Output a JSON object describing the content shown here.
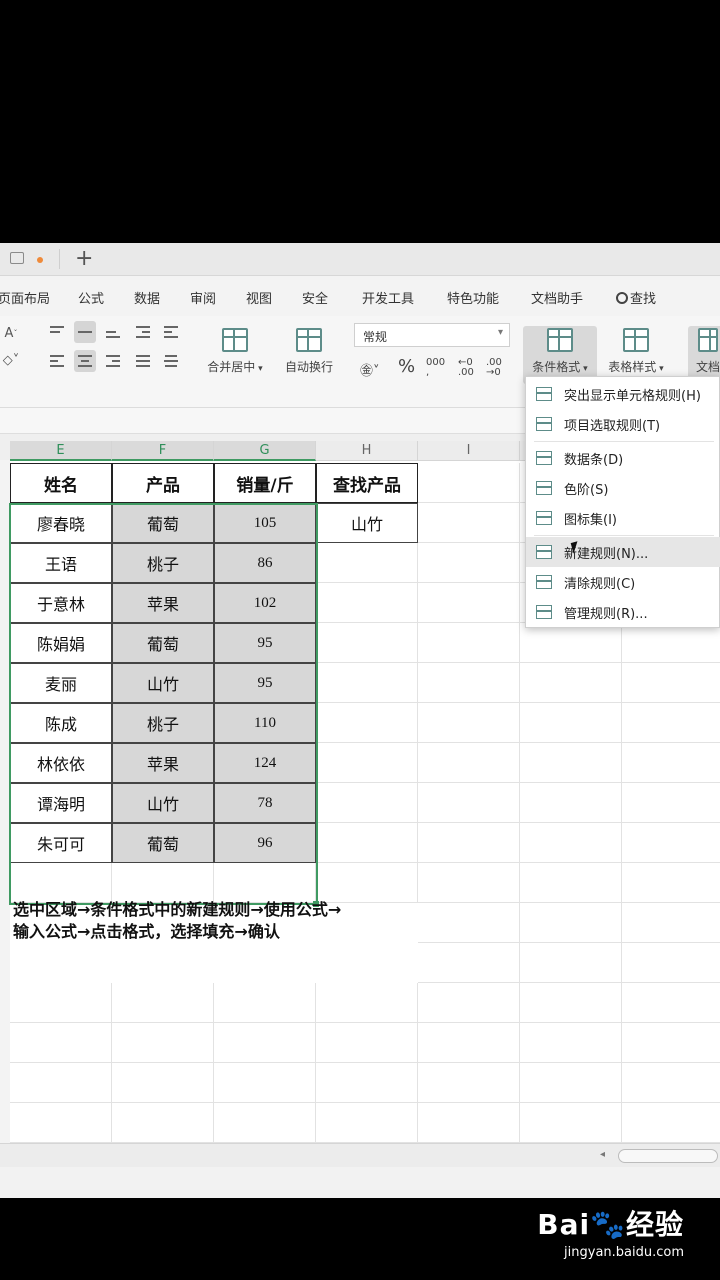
{
  "menu": {
    "items": [
      "页面布局",
      "公式",
      "数据",
      "审阅",
      "视图",
      "安全",
      "开发工具",
      "特色功能",
      "文档助手"
    ],
    "search_label": "查找"
  },
  "ribbon": {
    "merge_label": "合并居中",
    "wrap_label": "自动换行",
    "number_format": "常规",
    "percent": "%",
    "conditional_format_label": "条件格式",
    "table_style_label": "表格样式",
    "doc_label": "文档"
  },
  "sheet": {
    "columns": [
      "E",
      "F",
      "G",
      "H",
      "I"
    ],
    "headers": [
      "姓名",
      "产品",
      "销量/斤",
      "查找产品"
    ],
    "lookup_value": "山竹",
    "rows": [
      [
        "廖春晓",
        "葡萄",
        "105"
      ],
      [
        "王语",
        "桃子",
        "86"
      ],
      [
        "于意林",
        "苹果",
        "102"
      ],
      [
        "陈娟娟",
        "葡萄",
        "95"
      ],
      [
        "麦丽",
        "山竹",
        "95"
      ],
      [
        "陈成",
        "桃子",
        "110"
      ],
      [
        "林依依",
        "苹果",
        "124"
      ],
      [
        "谭海明",
        "山竹",
        "78"
      ],
      [
        "朱可可",
        "葡萄",
        "96"
      ]
    ],
    "note_line1": "选中区域→条件格式中的新建规则→使用公式→",
    "note_line2": "输入公式→点击格式，选择填充→确认"
  },
  "dropdown": {
    "items": [
      "突出显示单元格规则(H)",
      "项目选取规则(T)",
      "数据条(D)",
      "色阶(S)",
      "图标集(I)",
      "新建规则(N)...",
      "清除规则(C)",
      "管理规则(R)..."
    ],
    "highlighted_index": 5
  },
  "watermark": {
    "logo": "Bai🐾经验",
    "url": "jingyan.baidu.com"
  }
}
